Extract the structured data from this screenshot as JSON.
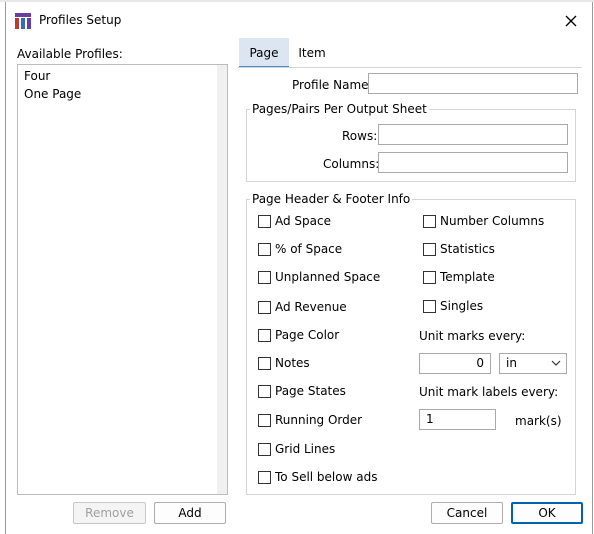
{
  "window": {
    "title": "Profiles Setup"
  },
  "left": {
    "label": "Available Profiles:",
    "profiles": [
      "Four",
      "One Page"
    ],
    "remove_label": "Remove",
    "add_label": "Add"
  },
  "tabs": [
    {
      "label": "Page",
      "active": true
    },
    {
      "label": "Item",
      "active": false
    }
  ],
  "page": {
    "profile_name_label": "Profile Name:",
    "profile_name_value": "",
    "pages_group": {
      "title": "Pages/Pairs Per Output Sheet",
      "rows_label": "Rows:",
      "rows_value": "",
      "columns_label": "Columns:",
      "columns_value": ""
    },
    "header_group": {
      "title": "Page Header & Footer Info",
      "left_checks": [
        {
          "label": "Ad Space",
          "checked": false
        },
        {
          "label": "% of Space",
          "checked": false
        },
        {
          "label": "Unplanned Space",
          "checked": false
        },
        {
          "label": "Ad Revenue",
          "checked": false
        },
        {
          "label": "Page Color",
          "checked": false
        },
        {
          "label": "Notes",
          "checked": false
        },
        {
          "label": "Page States",
          "checked": false
        },
        {
          "label": "Running Order",
          "checked": false
        },
        {
          "label": "Grid Lines",
          "checked": false
        },
        {
          "label": "To Sell below ads",
          "checked": false
        }
      ],
      "right_checks": [
        {
          "label": "Number Columns",
          "checked": false
        },
        {
          "label": "Statistics",
          "checked": false
        },
        {
          "label": "Template",
          "checked": false
        },
        {
          "label": "Singles",
          "checked": false
        }
      ],
      "unit_marks_label": "Unit marks every:",
      "unit_marks_value": "0",
      "unit_select_value": "in",
      "unit_labels_label": "Unit mark labels every:",
      "unit_labels_value": "1",
      "marks_suffix": "mark(s)"
    }
  },
  "footer": {
    "cancel_label": "Cancel",
    "ok_label": "OK"
  },
  "colors": {
    "accent": "#0063b1",
    "tab_active": "#dbe6f2",
    "icon_purple": "#6b3fa0",
    "icon_red": "#c0392b",
    "icon_blue": "#2e6fb8"
  }
}
